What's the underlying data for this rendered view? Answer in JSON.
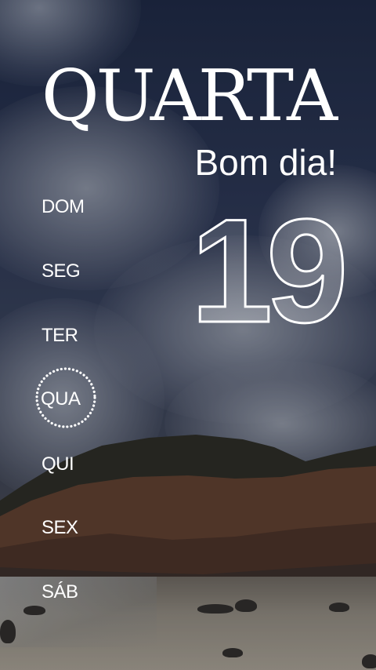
{
  "header": {
    "weekday": "QUARTA",
    "greeting": "Bom dia!"
  },
  "date": {
    "day": "19"
  },
  "days": {
    "items": [
      {
        "label": "DOM",
        "active": false
      },
      {
        "label": "SEG",
        "active": false
      },
      {
        "label": "TER",
        "active": false
      },
      {
        "label": "QUA",
        "active": true
      },
      {
        "label": "QUI",
        "active": false
      },
      {
        "label": "SEX",
        "active": false
      },
      {
        "label": "SÁB",
        "active": false
      }
    ]
  },
  "colors": {
    "text": "#ffffff",
    "sky": "#1d2740",
    "cliff": "#5a3a2a",
    "sand": "#a59d8f"
  }
}
